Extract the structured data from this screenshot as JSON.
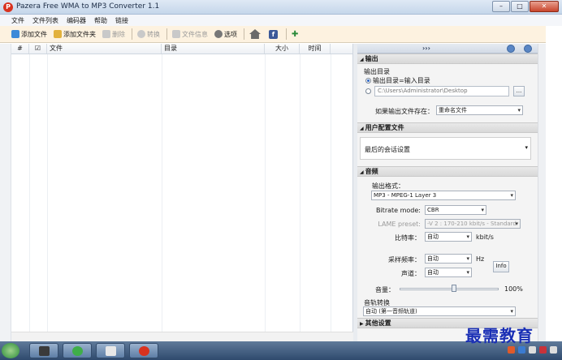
{
  "window": {
    "title": "Pazera Free WMA to MP3 Converter 1.1",
    "app_icon_glyph": "P",
    "buttons": [
      "–",
      "□",
      "✕"
    ]
  },
  "menu": {
    "items": [
      "文件",
      "文件列表",
      "编码器",
      "帮助",
      "链接"
    ]
  },
  "toolbar": {
    "add_files": "添加文件",
    "add_folder": "添加文件夹",
    "delete": "删除",
    "convert": "转换",
    "file_info": "文件信息",
    "options": "选项",
    "facebook_glyph": "f"
  },
  "list": {
    "columns": {
      "num": "#",
      "check": "☑",
      "file": "文件",
      "dir": "目录",
      "size": "大小",
      "time": "时间"
    }
  },
  "panel": {
    "collapse_label": "›››",
    "output": {
      "header": "输出",
      "dir_label": "输出目录",
      "option_same": "输出目录=输入目录",
      "path": "C:\\Users\\Administrator\\Desktop",
      "browse_label": "...",
      "exists_label": "如果输出文件存在：",
      "exists_value": "重命名文件"
    },
    "profile": {
      "header": "用户配置文件",
      "value": "最后的会话设置"
    },
    "audio": {
      "header": "音频",
      "format_label": "输出格式：",
      "format_value": "MP3 - MPEG-1 Layer 3",
      "bitrate_mode_label": "Bitrate mode:",
      "bitrate_mode_value": "CBR",
      "lame_label": "LAME preset:",
      "lame_value": "-V 2 : 170-210 kbit/s - Standard",
      "bitrate_label": "比特率：",
      "bitrate_value": "自动",
      "bitrate_unit": "kbit/s",
      "samplerate_label": "采样频率：",
      "samplerate_value": "自动",
      "samplerate_unit": "Hz",
      "channels_label": "声道：",
      "channels_value": "自动",
      "info_label": "Info",
      "volume_label": "音量：",
      "volume_percent": "100%",
      "volume_level": 0.55,
      "track_label": "音轨转换",
      "track_value": "自动 (第一音频轨道)"
    },
    "other": {
      "header": "其他设置"
    }
  },
  "watermark": "最需教育"
}
